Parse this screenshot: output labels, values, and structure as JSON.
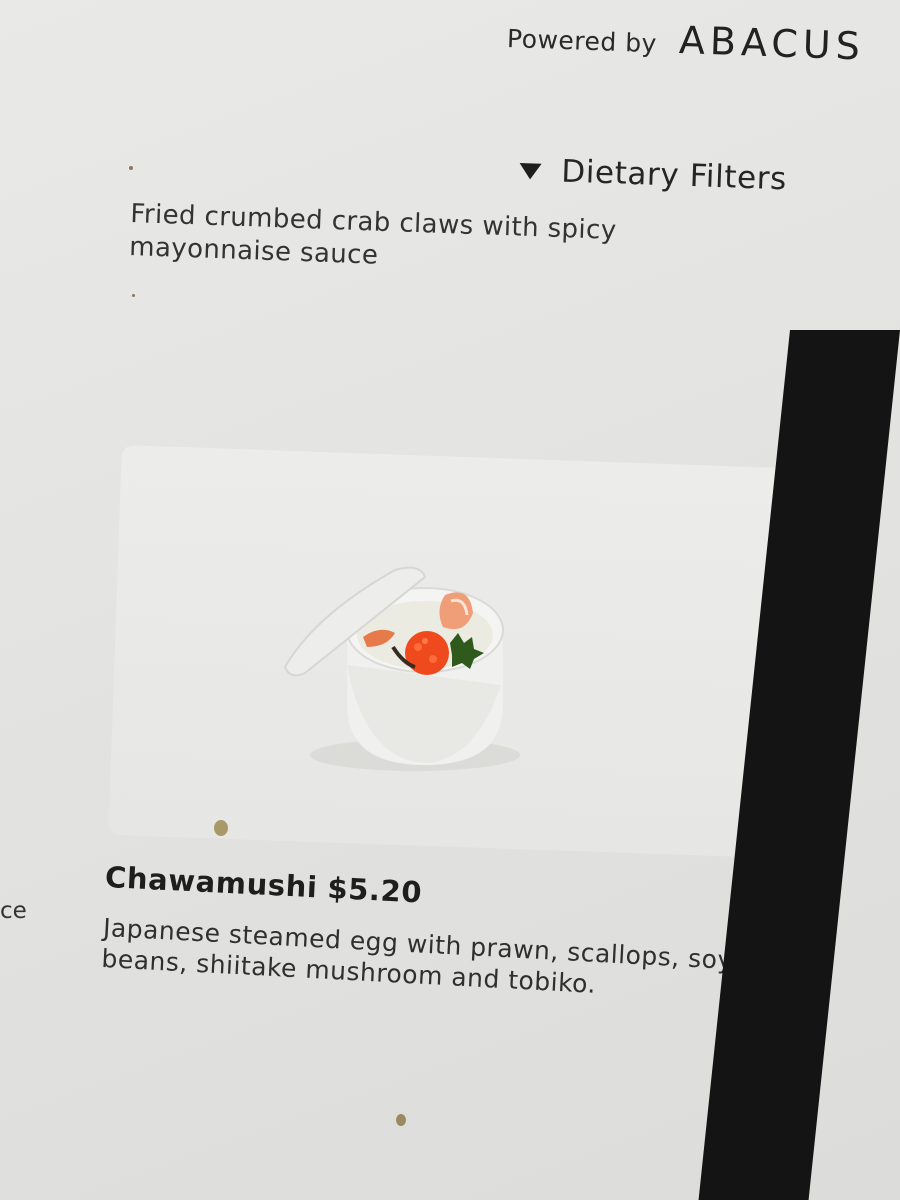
{
  "header": {
    "powered_by": "Powered by",
    "brand": "ABACUS"
  },
  "filters": {
    "label": "Dietary Filters",
    "icon": "triangle-down-icon"
  },
  "items": [
    {
      "description": "Fried crumbed crab claws with spicy mayonnaise sauce"
    },
    {
      "name": "Chawamushi",
      "price": "$5.20",
      "description": "Japanese steamed egg with prawn, scallops, soy beans, shiitake mushroom and tobiko.",
      "image": "chawanmushi-cup-image"
    }
  ],
  "left_column_fragment": "ce",
  "colors": {
    "background": "#e6e6e4",
    "text": "#2a2a2a",
    "bezel": "#141414"
  }
}
